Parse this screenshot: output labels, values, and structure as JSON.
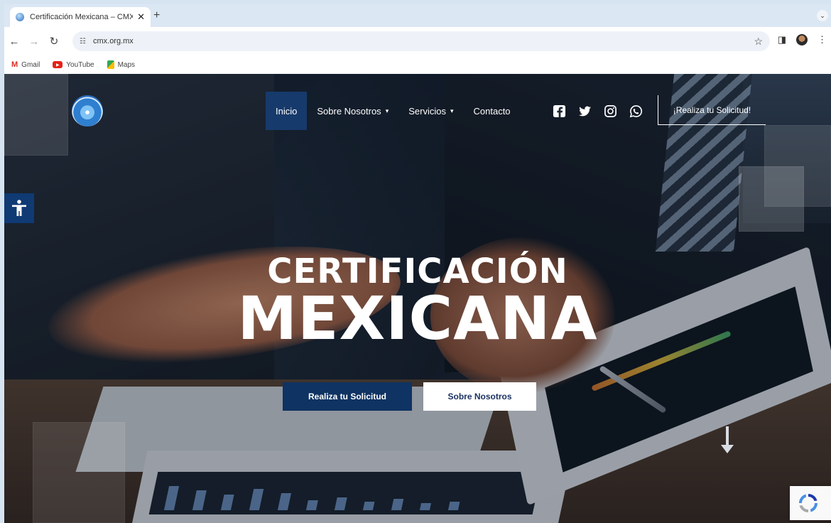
{
  "browser": {
    "tab_title": "Certificación Mexicana – CMX",
    "tab_close": "✕",
    "new_tab": "+",
    "tab_menu": "⌄",
    "address": "cmx.org.mx",
    "bookmarks": [
      {
        "label": "Gmail",
        "icon": "gmail-icon"
      },
      {
        "label": "YouTube",
        "icon": "youtube-icon"
      },
      {
        "label": "Maps",
        "icon": "maps-icon"
      }
    ]
  },
  "nav": {
    "items": [
      {
        "label": "Inicio",
        "active": true
      },
      {
        "label": "Sobre Nosotros",
        "dropdown": true
      },
      {
        "label": "Servicios",
        "dropdown": true
      },
      {
        "label": "Contacto"
      }
    ],
    "social": [
      "facebook-icon",
      "twitter-icon",
      "instagram-icon",
      "whatsapp-icon"
    ],
    "cta": "¡Realiza tu Solicitud!"
  },
  "hero": {
    "line1": "CERTIFICACIÓN",
    "line2": "MEXICANA",
    "primary_button": "Realiza tu Solicitud",
    "secondary_button": "Sobre Nosotros"
  },
  "colors": {
    "brand_navy": "#0f3362",
    "active_nav": "#163a6b",
    "accessibility_button": "#0f3a73"
  }
}
